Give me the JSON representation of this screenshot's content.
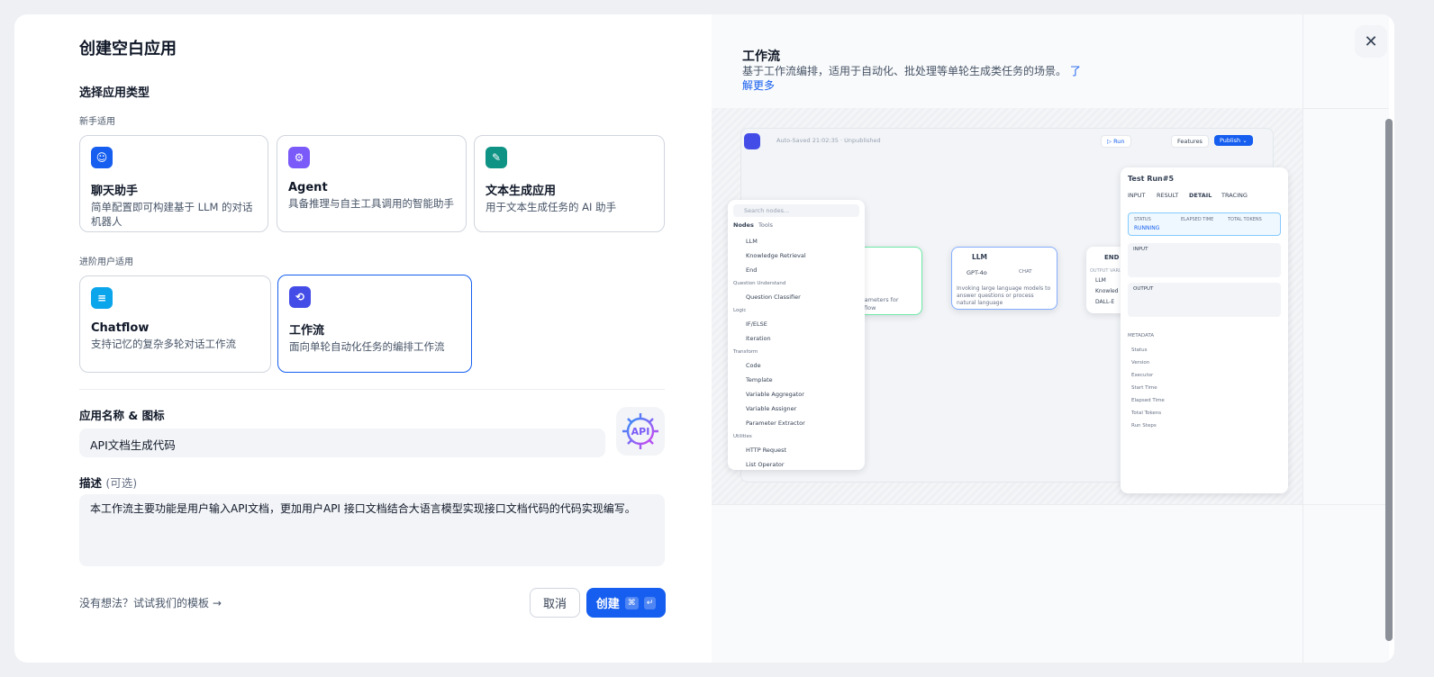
{
  "title": "创建空白应用",
  "select_type": "选择应用类型",
  "beginner": "新手适用",
  "advanced": "进阶用户适用",
  "cards": [
    {
      "title": "聊天助手",
      "desc": "简单配置即可构建基于 LLM 的对话机器人",
      "color": "#155eef"
    },
    {
      "title": "Agent",
      "desc": "具备推理与自主工具调用的智能助手",
      "color": "#7a5af8"
    },
    {
      "title": "文本生成应用",
      "desc": "用于文本生成任务的 AI 助手",
      "color": "#0e9384"
    },
    {
      "title": "Chatflow",
      "desc": "支持记忆的复杂多轮对话工作流",
      "color": "#0ba5ec"
    },
    {
      "title": "工作流",
      "desc": "面向单轮自动化任务的编排工作流",
      "color": "#444ce7"
    }
  ],
  "name_label": "应用名称 & 图标",
  "name_value": "API文档生成代码",
  "avatar_text": "API",
  "desc_label": "描述",
  "desc_optional": "(可选)",
  "desc_value": "本工作流主要功能是用户输入API文档，更加用户API 接口文档结合大语言模型实现接口文档代码的代码实现编写。",
  "template_link": "没有想法？试试我们的模板",
  "template_arrow": "→",
  "cancel": "取消",
  "create": "创建",
  "create_kbd1": "⌘",
  "create_kbd2": "↵",
  "close": "✕",
  "right_title": "工作流",
  "right_desc": "基于工作流编排，适用于自动化、批处理等单轮生成类任务的场景。",
  "learn_more": "了解更多",
  "preview": {
    "autosave": "Auto-Saved 21:02:35 · Unpublished",
    "run": "▷ Run",
    "features": "Features",
    "publish": "Publish ⌄",
    "search": "Search nodes...",
    "tabs": [
      "Nodes",
      "Tools"
    ],
    "nodes1": [
      "LLM",
      "Knowledge Retrieval",
      "End"
    ],
    "group_qu": "Question Understand",
    "nodes2": [
      "Question Classifier"
    ],
    "group_logic": "Logic",
    "nodes3": [
      "IF/ELSE",
      "Iteration"
    ],
    "group_transform": "Transform",
    "nodes4": [
      "Code",
      "Template",
      "Variable Aggregator",
      "Variable Assigner",
      "Parameter Extractor"
    ],
    "group_util": "Utilities",
    "nodes5": [
      "HTTP Request",
      "List Operator"
    ],
    "llm_title": "LLM",
    "llm_model": "GPT-4o",
    "llm_chat": "CHAT",
    "llm_desc": "Invoking large language models to answer questions or process natural language",
    "start_frag": "arameters for",
    "start_frag2": "flow",
    "end_title": "END",
    "end_output": "OUTPUT VARIA",
    "end_vars": [
      "LLM",
      "Knowled",
      "DALL-E"
    ],
    "testrun": "Test Run#5",
    "run_tabs": [
      "INPUT",
      "RESULT",
      "DETAIL",
      "TRACING"
    ],
    "status_label": "STATUS",
    "status": "RUNNING",
    "elapsed_label": "ELAPSED TIME",
    "tokens_label": "TOTAL TOKENS",
    "input": "INPUT",
    "output": "OUTPUT",
    "metadata": "METADATA",
    "meta_rows": [
      "Status",
      "Version",
      "Executor",
      "Start Time",
      "Elapsed Time",
      "Total Tokens",
      "Run Steps"
    ]
  }
}
